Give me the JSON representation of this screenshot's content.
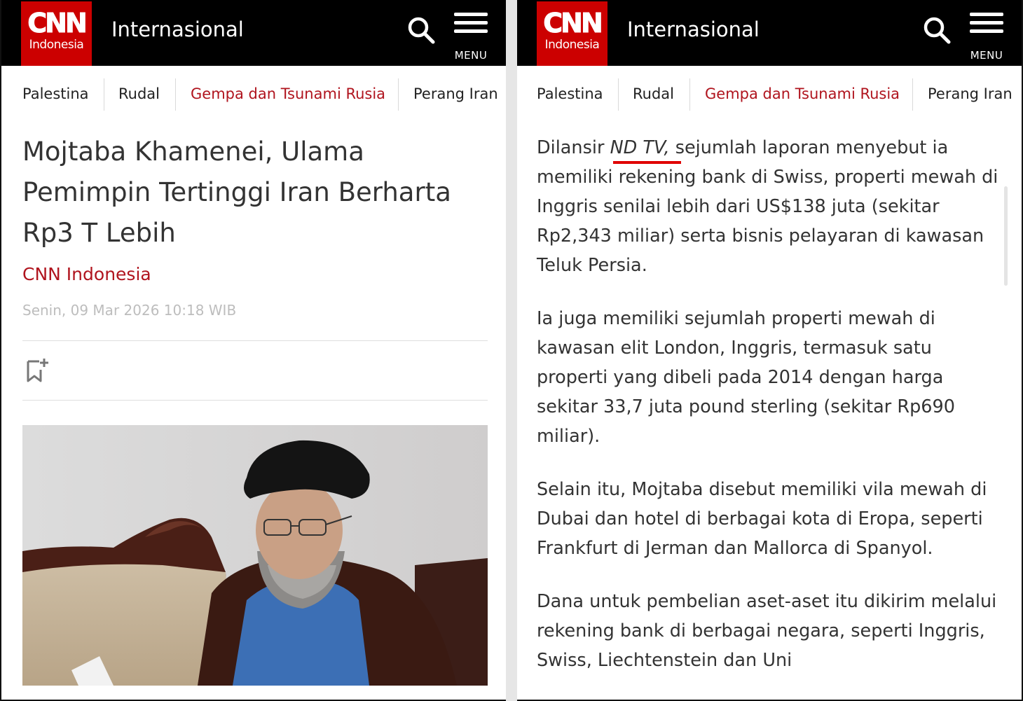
{
  "brand": {
    "logo_main": "CNN",
    "logo_sub": "Indonesia",
    "accent_color": "#cc0000",
    "link_color": "#b0141e"
  },
  "header": {
    "section": "Internasional",
    "menu_label": "MENU"
  },
  "tags": [
    {
      "label": "Palestina",
      "active": false
    },
    {
      "label": "Rudal",
      "active": false
    },
    {
      "label": "Gempa dan Tsunami Rusia",
      "active": true
    },
    {
      "label": "Perang Iran",
      "active": false
    }
  ],
  "article": {
    "headline": "Mojtaba Khamenei, Ulama Pemimpin Tertinggi Iran Berharta Rp3 T Lebih",
    "byline": "CNN Indonesia",
    "date": "Senin, 09 Mar 2026 10:18 WIB",
    "image_alt": "Mojtaba Khamenei"
  },
  "body": {
    "p1_lead": "Dilansir ",
    "p1_source": "ND TV,",
    "p1_rest": " sejumlah laporan menyebut ia memiliki rekening bank di Swiss, properti mewah di Inggris senilai lebih dari US$138 juta (sekitar Rp2,343 miliar) serta bisnis pelayaran di kawasan Teluk Persia.",
    "p2": "Ia juga memiliki sejumlah properti mewah di kawasan elit London, Inggris, termasuk satu properti yang dibeli pada 2014 dengan harga sekitar 33,7 juta pound sterling (sekitar Rp690 miliar).",
    "p3": "Selain itu, Mojtaba disebut memiliki vila mewah di Dubai dan hotel di berbagai kota di Eropa, seperti Frankfurt di Jerman dan Mallorca di Spanyol.",
    "p4": "Dana untuk pembelian aset-aset itu dikirim melalui rekening bank di berbagai negara, seperti Inggris, Swiss, Liechtenstein dan Uni"
  }
}
